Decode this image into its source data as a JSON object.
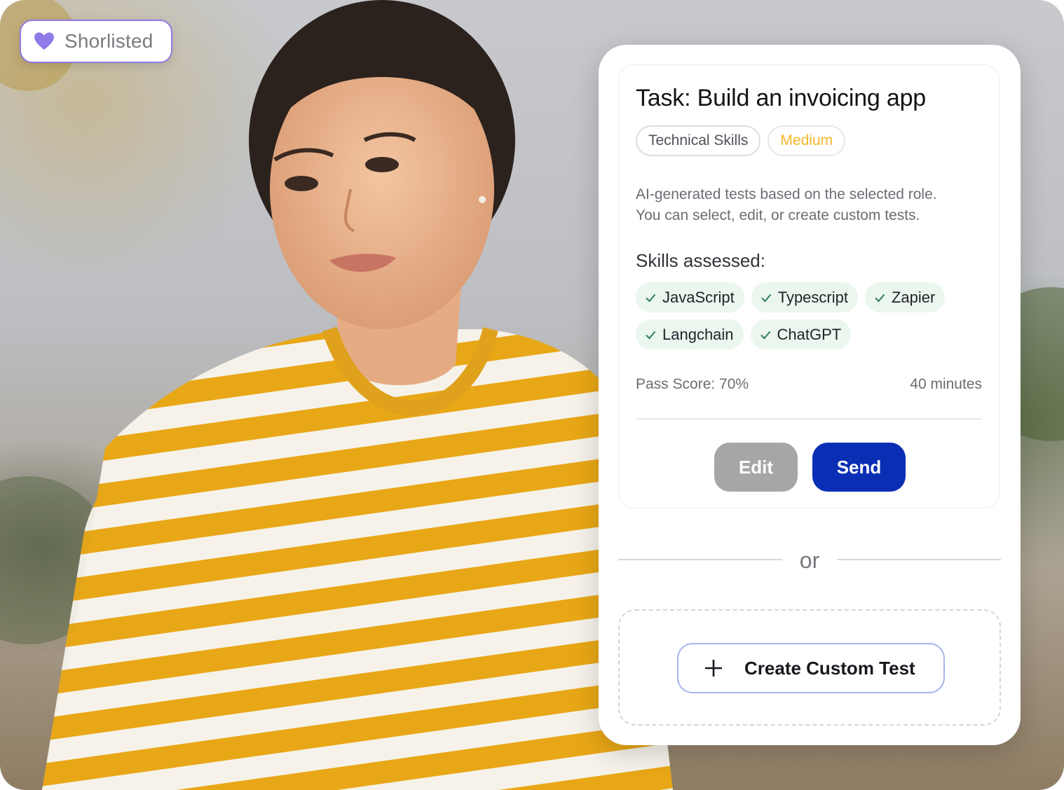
{
  "badge": {
    "label": "Shorlisted",
    "icon": "heart-icon",
    "color": "#8f7ae8"
  },
  "task": {
    "title": "Task: Build an invoicing app",
    "tags": [
      {
        "label": "Technical Skills"
      },
      {
        "label": "Medium",
        "color": "#f2b62a"
      }
    ],
    "description_line1": "AI-generated tests based on the selected role.",
    "description_line2": "You can select, edit, or create custom tests.",
    "skills_heading": "Skills assessed:",
    "skills": [
      "JavaScript",
      "Typescript",
      "Zapier",
      "Langchain",
      "ChatGPT"
    ],
    "pass_score": "Pass Score: 70%",
    "duration": "40 minutes",
    "edit_label": "Edit",
    "send_label": "Send"
  },
  "separator": {
    "label": "or"
  },
  "custom": {
    "label": "Create Custom Test",
    "icon": "plus-icon"
  },
  "colors": {
    "send": "#0a2fb4",
    "edit": "#a6a6a6",
    "chip_bg": "#eaf6ee",
    "check": "#2e7d5b"
  }
}
